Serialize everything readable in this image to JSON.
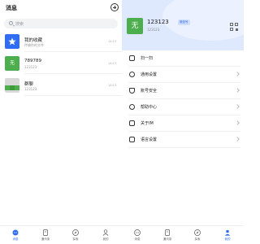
{
  "messages": {
    "title": "消息",
    "search_placeholder": "搜索",
    "conversations": [
      {
        "name": "我的收藏",
        "subtitle": "传输你的文件",
        "time": "14:13",
        "avatar": "star-icon"
      },
      {
        "name": "789789",
        "subtitle": "123123",
        "time": "14:13",
        "avatar_text": "无"
      },
      {
        "name": "群聊",
        "subtitle": "123123",
        "time": "14:13",
        "avatar": "group-avatar"
      }
    ]
  },
  "tabbar": {
    "tabs": [
      {
        "label": "消息",
        "icon": "chat-icon"
      },
      {
        "label": "通讯录",
        "icon": "contacts-icon"
      },
      {
        "label": "探索",
        "icon": "compass-icon"
      },
      {
        "label": "我的",
        "icon": "person-icon"
      }
    ],
    "active_color": "#2f6df6"
  },
  "profile": {
    "avatar_text": "无",
    "name": "123123",
    "badge": "微信号",
    "id": "123123",
    "menu": [
      {
        "label": "扫一扫",
        "icon": "scan-icon"
      },
      {
        "label": "通用设置",
        "icon": "settings-icon"
      },
      {
        "label": "账号安全",
        "icon": "shield-icon"
      },
      {
        "label": "帮助中心",
        "icon": "help-icon"
      },
      {
        "label": "关于IM",
        "icon": "info-icon"
      },
      {
        "label": "语言设置",
        "icon": "language-icon"
      }
    ]
  },
  "colors": {
    "accent": "#2f6df6",
    "avatar_green": "#4cae4c",
    "hero_bg": "#dfe9fd"
  }
}
